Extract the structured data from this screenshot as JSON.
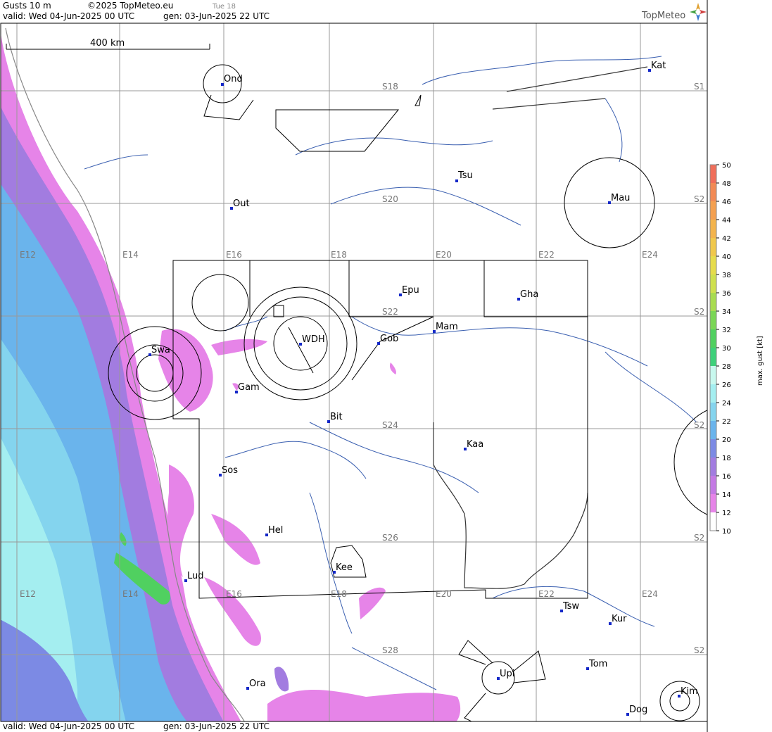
{
  "header": {
    "title": "Gusts 10 m",
    "copyright": "©2025 TopMeteo.eu",
    "day": "Tue 18",
    "valid": "valid:  Wed  04-Jun-2025  00 UTC",
    "gen": "gen: 03-Jun-2025 22 UTC",
    "brand": "TopMeteo"
  },
  "footer": {
    "valid": "valid:  Wed  04-Jun-2025  00 UTC",
    "gen": "gen: 03-Jun-2025 22 UTC"
  },
  "scale_bar": {
    "label": "400 km"
  },
  "legend": {
    "title": "max. gust [kt]",
    "ticks": [
      "50",
      "48",
      "46",
      "44",
      "42",
      "40",
      "38",
      "36",
      "34",
      "32",
      "30",
      "28",
      "26",
      "24",
      "22",
      "20",
      "18",
      "16",
      "14",
      "12",
      "10"
    ],
    "colors": [
      "#f06e5a",
      "#f28a55",
      "#f4a050",
      "#f3b44d",
      "#f0c84c",
      "#e6dc4c",
      "#cfe04e",
      "#a8dc50",
      "#7ad655",
      "#50d060",
      "#3ed07a",
      "#c8f8ee",
      "#a4eef0",
      "#84d4ee",
      "#6ab4ec",
      "#7c8ae4",
      "#a27ce0",
      "#c47ae4",
      "#e684e8",
      "#ffffff"
    ]
  },
  "grid": {
    "lon_labels": [
      "E12",
      "E14",
      "E16",
      "E18",
      "E20",
      "E22",
      "E24"
    ],
    "lat_labels": [
      "S18",
      "S20",
      "S22",
      "S24",
      "S26",
      "S28"
    ],
    "edge_labels": [
      "S1",
      "S2",
      "S2",
      "S2",
      "S2",
      "S2"
    ]
  },
  "cities": [
    "Ond",
    "Out",
    "Tsu",
    "Kat",
    "Mau",
    "Epu",
    "Gha",
    "Swa",
    "WDH",
    "Gob",
    "Mam",
    "Gam",
    "Bit",
    "Kaa",
    "Sos",
    "Hel",
    "Kee",
    "Lud",
    "Tsw",
    "Kur",
    "Tom",
    "Upi",
    "Ora",
    "Kim",
    "Dog"
  ]
}
